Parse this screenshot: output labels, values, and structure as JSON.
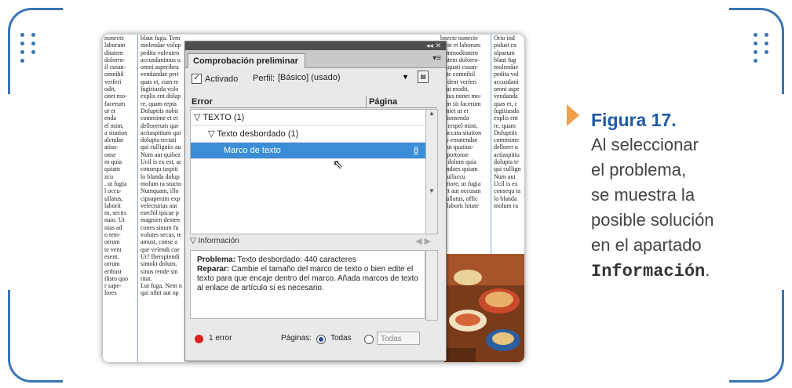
{
  "panel": {
    "title": "Comprobación preliminar",
    "top_controls": "◂◂  ✕",
    "menu_icon": "▾≡",
    "active_label": "Activado",
    "profile_label": "Perfil:",
    "profile_value": "[Básico] (usado)",
    "col_error": "Error",
    "col_page": "Página",
    "items": [
      {
        "label": "TEXTO (1)",
        "page": ""
      },
      {
        "label": "Texto desbordado (1)",
        "page": ""
      },
      {
        "label": "Marco de texto",
        "page": "8"
      }
    ],
    "info_label": "Información",
    "problem_label": "Problema:",
    "problem_text": "Texto desbordado: 440 caracteres",
    "repair_label": "Reparar:",
    "repair_text": "Cambie el tamaño del marco de texto o bien edite el texto para que encaje dentro del marco. Añada marcos de texto al enlace de artículo si es necesario.",
    "error_count": "1 error",
    "pages_label": "Páginas:",
    "pages_option": "Todas",
    "pages_select": "Todas"
  },
  "caption": {
    "title": "Figura 17.",
    "lines": [
      "Al seleccionar",
      "el problema,",
      "se muestra la",
      "posible solución",
      "en el apartado"
    ],
    "mono": "Información",
    "end": "."
  },
  "doc_text": {
    "col1": "nonecte\nlaborum\nditatem\ndolorro-\nil cusan-\nomnihil\nverferi\nodit,\nonet mo-\nfacerum\nut et\nenda\nel mint,\na sitation\nalendae\natius-\nonse\nm quia\nquiam\nzcu\n. ut fugia\nl occu-\nullatus,\nlaborit\nm, sectis\nnaio. Ut\nnias ad\no tem-\norrum\nte vent\nesent.\norrum\neribust\nilisto quo\nr sape-\nlores",
    "col2": "blaut fuga. Tem\nmolendae volup\npedita volenien\naccusdanimus u\nomni asperibea\nvendandae peri\nquas et, cum re\nfugitiusda volo\nexplis ent dolup\nre, quam repta\nDoluptiis nobit\ncommime et et\ndellorerum que\nactiaspitium qui\ndolupta tectati\nqui culligniis au\nNum aut quibez\nUcil is ex est, ac\nconsequ taspiti\nlo blanda dolup\nmolum ra stucto\nNumquam, illo\ncipsaperum exp\nvelecturias aut\nearchil ipicae p\nmagnien desten\ncones sinum fu\nvolutes secus, te\namust, conse a\nque velendi cae\nUt? Iberspiendi\nsimokt dolum,\nsinus rende sin\ntitat.\nLut fuga. Nem n\nqui nihit aut op",
    "col3": "bnecte nonecte\natest et laborum\ncommoditatem\nptatem dolorro-\n. Aquati cusan-\ntiate comnihil\nea dent verferi\n, aut modit,\nriatus nonet mo-\nnem sit facerum\ngeniet ut et\ntationsenda\ned erspel mint,\nit accata sitation\nsep ernatendae\nit, ut quatius-\nnt portonse\npa dolum quia\npendaes quiam\nlit ullaccu\nperiore, ut fugia\nmet aut occusan\nis ullatus, offic\nm laborit hitate",
    "col4": "Orio ind\npidust ex\nulparum\nblaut fug\nmolendae\npedita vol\naccusdani\nomni aspe\nvendanda\nquas et, c\nfugitiusda\nexplis ent\nre, quam\nDoluptiis\ncommime\ndellorer u\nactiaspitiu\ndolupta te\nqui cullign\nNum aut\nUcil is ex\nconsequ ta\nlo blanda\nmolum ra"
  },
  "colors": {
    "frame": "#3a75b5",
    "accent_arrow": "#f0a14e",
    "selection": "#3b8ed6",
    "figure_title": "#1f5aa6",
    "error_dot": "#e02020"
  }
}
